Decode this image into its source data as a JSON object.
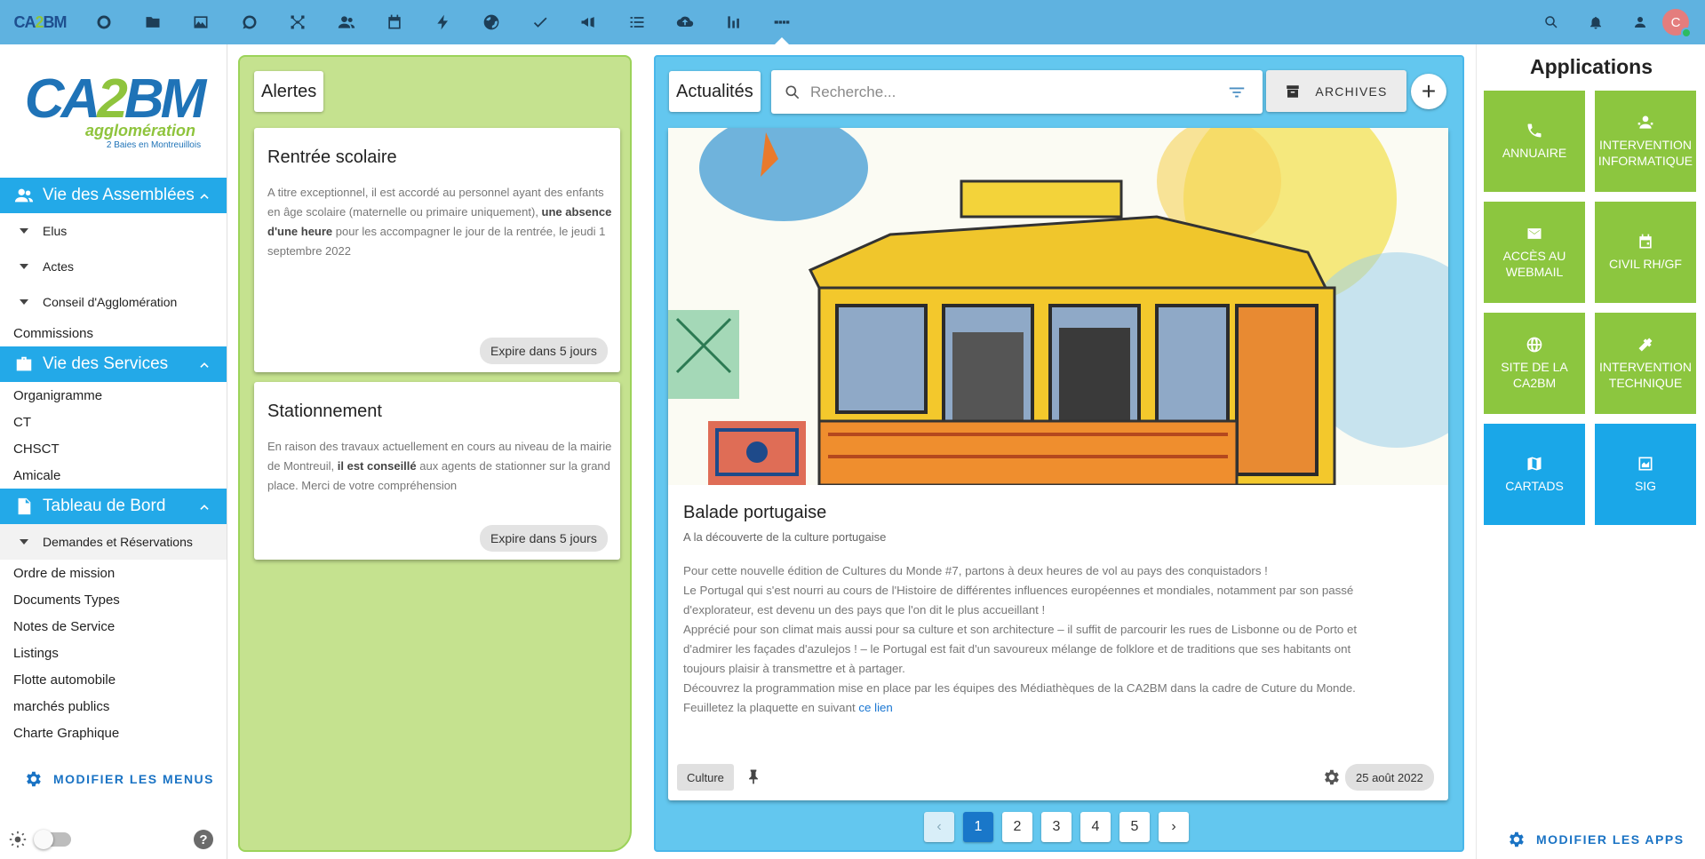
{
  "topbar": {
    "logo_left": "CA",
    "logo_mid": "2",
    "logo_right": "BM",
    "nav_icons": [
      "circle-icon",
      "folder-icon",
      "image-icon",
      "chat-icon",
      "network-icon",
      "users-icon",
      "calendar-icon",
      "bolt-icon",
      "globe-icon",
      "check-icon",
      "megaphone-icon",
      "list-icon",
      "cloud-upload-icon",
      "bar-chart-icon",
      "ca2bm-logo-icon"
    ],
    "right_icons": [
      "search-icon",
      "bell-icon",
      "account-icon"
    ],
    "avatar_letter": "C"
  },
  "sidebar": {
    "logo_main_left": "CA",
    "logo_main_mid": "2",
    "logo_main_right": "BM",
    "logo_sub": "agglomération",
    "logo_sub2": "2 Baies en Montreuillois",
    "sections": [
      {
        "title": "Vie des Assemblées",
        "subs": [
          "Elus",
          "Actes",
          "Conseil d'Agglomération"
        ],
        "leaves": [
          "Commissions"
        ]
      },
      {
        "title": "Vie des Services",
        "leaves": [
          "Organigramme",
          "CT",
          "CHSCT",
          "Amicale"
        ]
      },
      {
        "title": "Tableau de Bord",
        "subs": [
          "Demandes et Réservations"
        ],
        "leaves": [
          "Ordre de mission",
          "Documents Types",
          "Notes de Service",
          "Listings",
          "Flotte automobile",
          "marchés publics",
          "Charte Graphique"
        ]
      }
    ],
    "modify_menus": "MODIFIER LES MENUS",
    "help": "?"
  },
  "alerts": {
    "title": "Alertes",
    "cards": [
      {
        "title": "Rentrée scolaire",
        "text_before": "A titre exceptionnel, il est accordé au personnel ayant des enfants en âge scolaire (maternelle ou primaire uniquement), ",
        "text_bold": "une absence d'une heure",
        "text_after": " pour les accompagner le jour de la rentrée, le jeudi 1 septembre 2022",
        "expires": "Expire dans 5 jours"
      },
      {
        "title": "Stationnement",
        "text_before": "En raison des travaux actuellement en cours au niveau de la mairie de Montreuil, ",
        "text_bold": "il est conseillé",
        "text_after": " aux agents de stationner sur la grand place. Merci de votre compréhension",
        "expires": "Expire dans 5 jours"
      }
    ]
  },
  "news": {
    "title": "Actualités",
    "search_placeholder": "Recherche...",
    "archives": "ARCHIVES",
    "add": "+",
    "article": {
      "title": "Balade portugaise",
      "subtitle": "A la découverte de la culture portugaise",
      "lines": [
        "Pour cette nouvelle édition de Cultures du Monde #7, partons à deux heures de vol au pays des conquistadors !",
        "Le Portugal qui s'est nourri au cours de l'Histoire de différentes influences européennes et mondiales, notamment par son passé",
        "d'explorateur, est devenu un des pays que l'on dit le plus accueillant !",
        "Apprécié pour son climat mais aussi pour sa culture et son architecture – il suffit de parcourir les rues de Lisbonne ou de Porto et",
        "d'admirer les façades d'azulejos ! – le Portugal est fait d'un savoureux mélange de folklore et de traditions que ses habitants ont",
        "toujours plaisir à transmettre et à partager.",
        " Découvrez la programmation mise en place par les équipes des Médiathèques de la CA2BM dans la cadre de Cuture du Monde."
      ],
      "last_line_prefix": "Feuilletez la plaquette en suivant ",
      "link": "ce lien",
      "tag": "Culture",
      "date": "25 août 2022"
    },
    "pages": [
      "1",
      "2",
      "3",
      "4",
      "5"
    ],
    "prev": "‹",
    "next": "›"
  },
  "apps": {
    "title": "Applications",
    "tiles": [
      {
        "label": "ANNUAIRE",
        "icon": "phone-icon",
        "color": "green"
      },
      {
        "label": "INTERVENTION INFORMATIQUE",
        "icon": "support-icon",
        "color": "green"
      },
      {
        "label": "ACCÈS AU WEBMAIL",
        "icon": "mail-icon",
        "color": "green"
      },
      {
        "label": "CIVIL RH/GF",
        "icon": "calendar-icon",
        "color": "green"
      },
      {
        "label": "SITE DE LA CA2BM",
        "icon": "globe-icon",
        "color": "green"
      },
      {
        "label": "INTERVENTION TECHNIQUE",
        "icon": "tools-icon",
        "color": "green"
      },
      {
        "label": "CARTADS",
        "icon": "map-icon",
        "color": "blue"
      },
      {
        "label": "SIG",
        "icon": "sig-icon",
        "color": "blue"
      }
    ],
    "modify_apps": "MODIFIER LES APPS"
  },
  "colors": {
    "topbar": "#5fb2e0",
    "section_head": "#23a9e8",
    "alerts_bg": "#c5e28f",
    "news_bg": "#63c7ef",
    "tile_green": "#8cc63f",
    "tile_blue": "#1aa7e8",
    "link": "#1a73c4"
  }
}
